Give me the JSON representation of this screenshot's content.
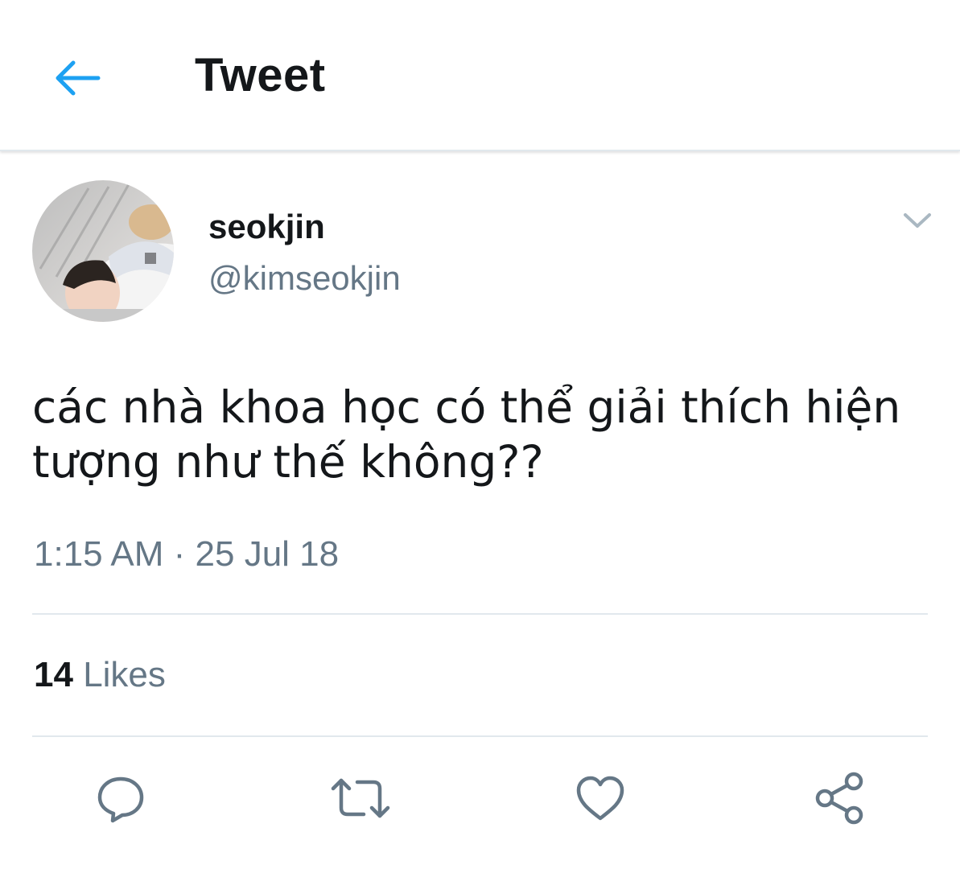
{
  "header": {
    "back_icon": "arrow-left-icon",
    "title": "Tweet"
  },
  "tweet": {
    "author": {
      "display_name": "seokjin",
      "handle": "@kimseokjin"
    },
    "menu_icon": "chevron-down-icon",
    "text": "các nhà khoa học có thể giải thích hiện tượng như thế không??",
    "timestamp": "1:15 AM · 25 Jul 18",
    "stats": {
      "likes_count": "14",
      "likes_label": "Likes"
    },
    "actions": [
      {
        "name": "reply",
        "icon": "reply-icon"
      },
      {
        "name": "retweet",
        "icon": "retweet-icon"
      },
      {
        "name": "like",
        "icon": "heart-icon"
      },
      {
        "name": "share",
        "icon": "share-icon"
      }
    ]
  },
  "colors": {
    "accent": "#1da1f2",
    "text_primary": "#14171a",
    "text_secondary": "#657786",
    "divider": "#e1e8ed"
  }
}
